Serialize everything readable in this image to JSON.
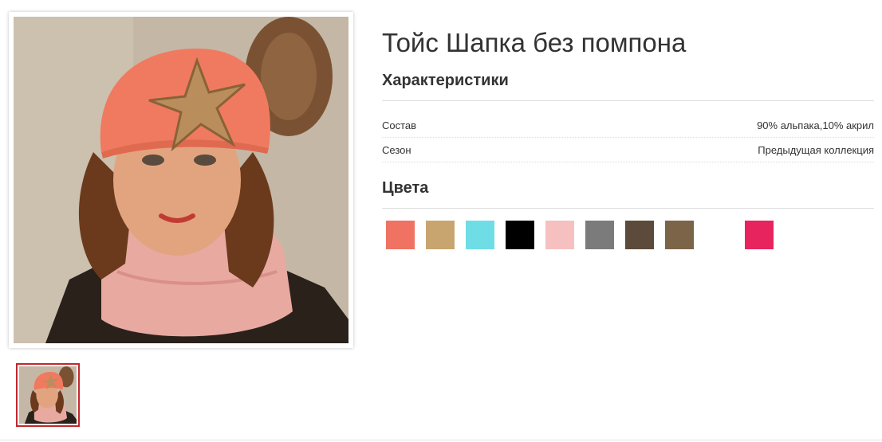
{
  "product": {
    "title": "Тойс Шапка без помпона",
    "main_image_alt": "product-photo",
    "thumbnail_count": 1
  },
  "specs": {
    "heading": "Характеристики",
    "rows": [
      {
        "label": "Состав",
        "value": "90% альпака,10% акрил"
      },
      {
        "label": "Сезон",
        "value": "Предыдущая коллекция"
      }
    ]
  },
  "colors": {
    "heading": "Цвета",
    "swatches": [
      "#f07262",
      "#c8a56f",
      "#6fdde6",
      "#000000",
      "#f7c0c0",
      "#7b7b7b",
      "#5c4a3a",
      "#7b6448",
      "#ffffff",
      "#e8245e"
    ]
  },
  "style": {
    "thumb_border": "#c0282d"
  }
}
